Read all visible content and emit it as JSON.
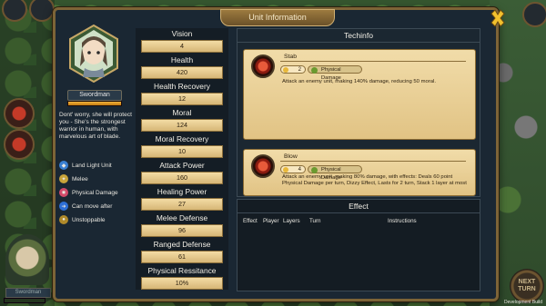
{
  "window": {
    "title": "Unit Information"
  },
  "hero": {
    "name": "Swordman",
    "health_fraction": 1.0,
    "bio": "Dont' worry, she will protect you - She's the strongest warrior in human, with marvelous art of blade."
  },
  "traits": [
    {
      "label": "Land Light Unit",
      "icon": "shield-icon",
      "color": "#3a7fd0"
    },
    {
      "label": "Melee",
      "icon": "sword-icon",
      "color": "#c8a43a"
    },
    {
      "label": "Physical Damage",
      "icon": "burst-icon",
      "color": "#d24a6a"
    },
    {
      "label": "Can move after",
      "icon": "footsteps-icon",
      "color": "#2e6fd6"
    },
    {
      "label": "Unstoppable",
      "icon": "fist-icon",
      "color": "#b08a2a"
    }
  ],
  "stats": [
    {
      "label": "Vision",
      "value": "4"
    },
    {
      "label": "Health",
      "value": "420"
    },
    {
      "label": "Health Recovery",
      "value": "12"
    },
    {
      "label": "Moral",
      "value": "124"
    },
    {
      "label": "Moral Recovery",
      "value": "10"
    },
    {
      "label": "Attack Power",
      "value": "160"
    },
    {
      "label": "Healing Power",
      "value": "27"
    },
    {
      "label": "Melee Defense",
      "value": "96"
    },
    {
      "label": "Ranged Defense",
      "value": "61"
    },
    {
      "label": "Physical Ressitance",
      "value": "10%"
    }
  ],
  "techinfo": {
    "title": "Techinfo",
    "skills": [
      {
        "name": "Stab",
        "cooldown": "2",
        "damage_type": "Physical Damage",
        "description": "Attack an enemy unit, making 140% damage, reducing 50 moral."
      },
      {
        "name": "Blow",
        "cooldown": "4",
        "damage_type": "Physical Damage",
        "description": "Attack an enemy unit, making 80% damage, with effects: Deals 60 point Physical Damage per turn, Dizzy Effect, Lasts for 2 turn, Stack 1 layer at most"
      }
    ]
  },
  "effect": {
    "title": "Effect",
    "columns": [
      "Effect",
      "Player",
      "Layers",
      "Turn",
      "Instructions"
    ]
  },
  "hud": {
    "next_turn_line1": "NEXT",
    "next_turn_line2": "TURN",
    "bottom_unit_name": "Swordman",
    "build_label": "Development Build",
    "accent": "#7d6437",
    "panel_bg": "#1a2733"
  }
}
